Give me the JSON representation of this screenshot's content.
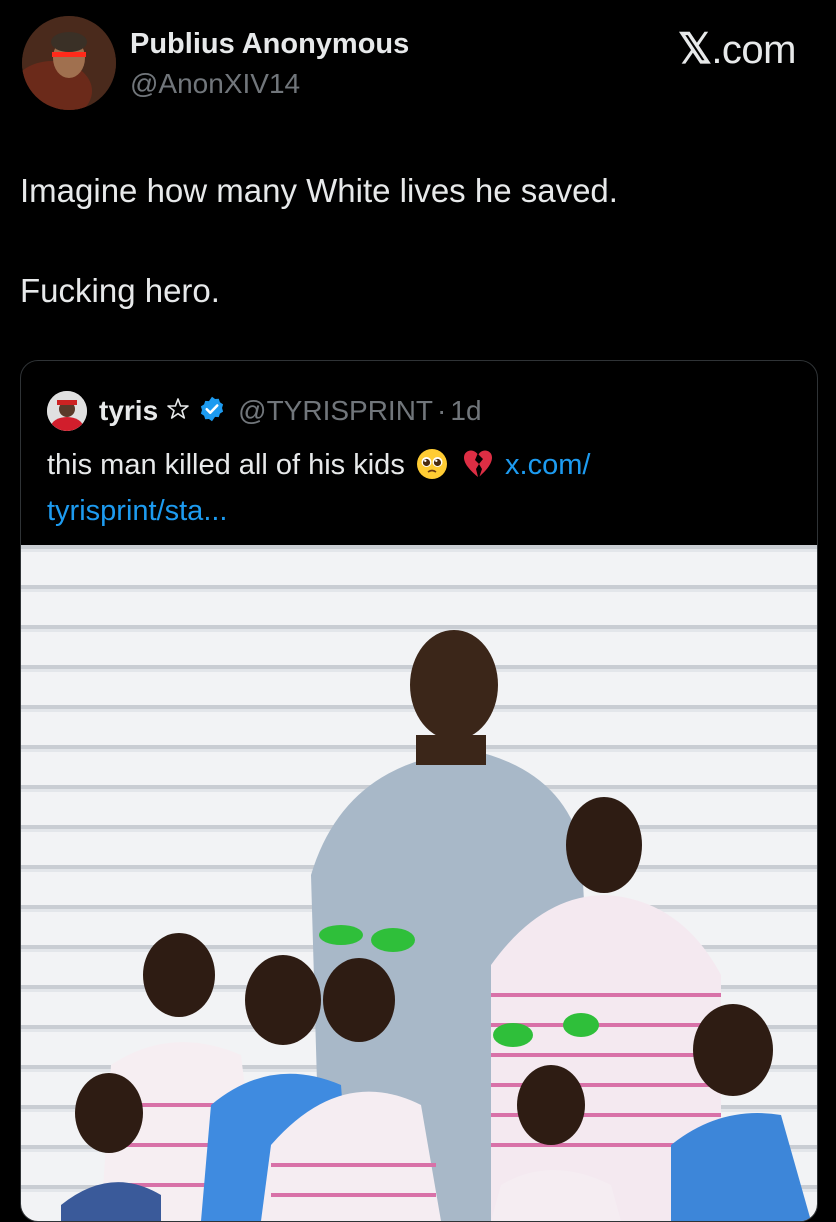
{
  "author": {
    "name": "Publius Anonymous",
    "handle": "@AnonXIV14"
  },
  "brand": {
    "x_glyph": "𝕏",
    "domain": ".com"
  },
  "tweet": {
    "line1": "Imagine how many White lives he saved.",
    "line2": "Fucking hero."
  },
  "quoted": {
    "name": "tyris",
    "handle": "@TYRISPRINT",
    "dot": "·",
    "time": "1d",
    "text": "this man killed all of his kids",
    "emojis": [
      "pleading-face-icon",
      "broken-heart-icon"
    ],
    "link_part1": "x.com/",
    "link_part2": "tyrisprint/sta..."
  },
  "colors": {
    "background": "#000000",
    "text": "#e7e9ea",
    "muted": "#71767b",
    "link": "#1d9bf0",
    "verified": "#1d9bf0"
  }
}
